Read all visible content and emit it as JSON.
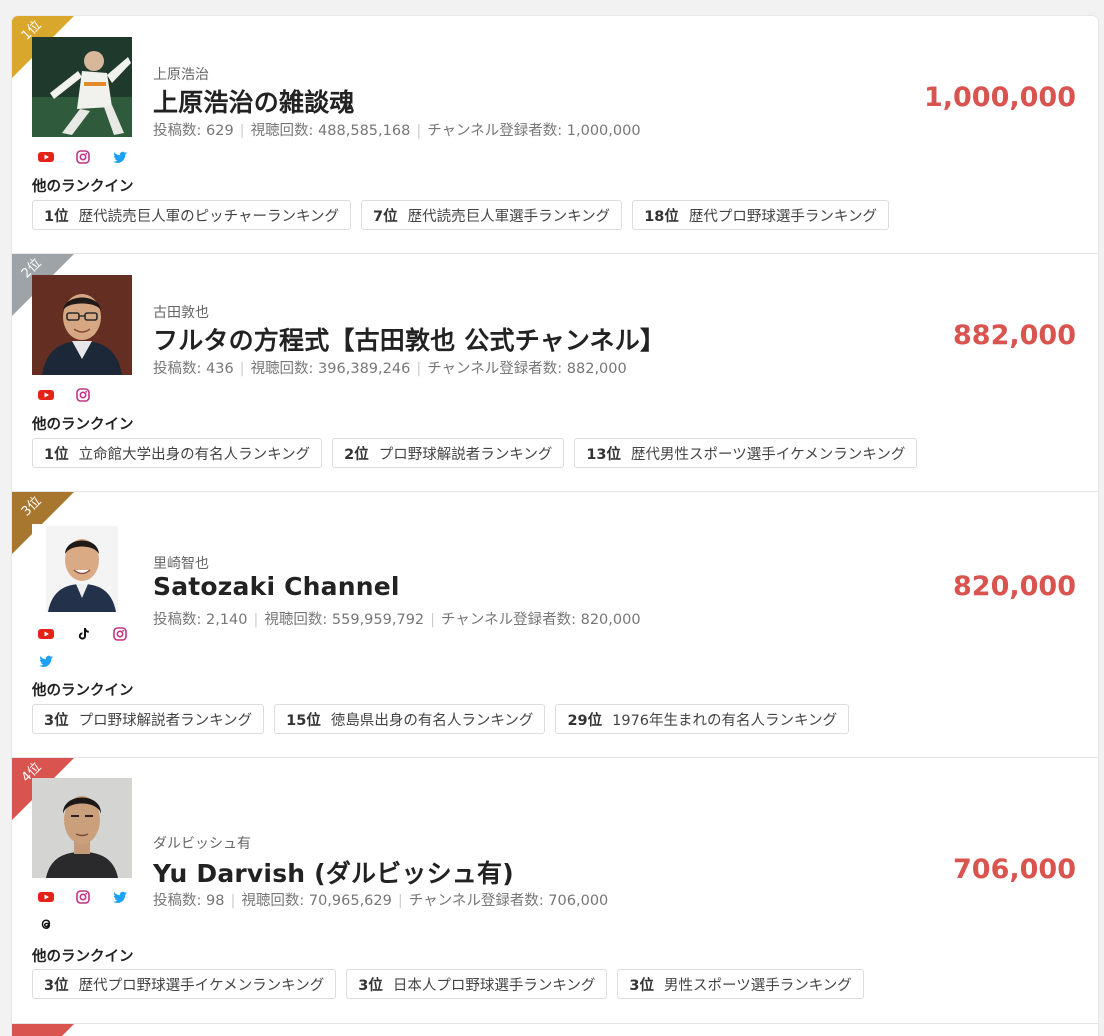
{
  "entries": [
    {
      "rank_label": "1位",
      "ribbon_color": "#d9a72c",
      "sub_name": "上原浩治",
      "channel_name": "上原浩治の雑談魂",
      "stats": {
        "posts": "投稿数: 629",
        "views": "視聴回数: 488,585,168",
        "subscribers": "チャンネル登録者数: 1,000,000"
      },
      "subscriber_count": "1,000,000",
      "sns": [
        "youtube-icon",
        "instagram-icon",
        "twitter-icon"
      ],
      "other_heading": "他のランクイン",
      "tags": [
        {
          "pos": "1位",
          "label": "歴代読売巨人軍のピッチャーランキング"
        },
        {
          "pos": "7位",
          "label": "歴代読売巨人軍選手ランキング"
        },
        {
          "pos": "18位",
          "label": "歴代プロ野球選手ランキング"
        }
      ]
    },
    {
      "rank_label": "2位",
      "ribbon_color": "#9ea3a8",
      "sub_name": "古田敦也",
      "channel_name": "フルタの方程式【古田敦也 公式チャンネル】",
      "stats": {
        "posts": "投稿数: 436",
        "views": "視聴回数: 396,389,246",
        "subscribers": "チャンネル登録者数: 882,000"
      },
      "subscriber_count": "882,000",
      "sns": [
        "youtube-icon",
        "instagram-icon"
      ],
      "other_heading": "他のランクイン",
      "tags": [
        {
          "pos": "1位",
          "label": "立命館大学出身の有名人ランキング"
        },
        {
          "pos": "2位",
          "label": "プロ野球解説者ランキング"
        },
        {
          "pos": "13位",
          "label": "歴代男性スポーツ選手イケメンランキング"
        }
      ]
    },
    {
      "rank_label": "3位",
      "ribbon_color": "#a8772f",
      "sub_name": "里崎智也",
      "channel_name": "Satozaki Channel",
      "stats": {
        "posts": "投稿数: 2,140",
        "views": "視聴回数: 559,959,792",
        "subscribers": "チャンネル登録者数: 820,000"
      },
      "subscriber_count": "820,000",
      "sns": [
        "youtube-icon",
        "tiktok-icon",
        "instagram-icon",
        "twitter-icon"
      ],
      "other_heading": "他のランクイン",
      "tags": [
        {
          "pos": "3位",
          "label": "プロ野球解説者ランキング"
        },
        {
          "pos": "15位",
          "label": "徳島県出身の有名人ランキング"
        },
        {
          "pos": "29位",
          "label": "1976年生まれの有名人ランキング"
        }
      ]
    },
    {
      "rank_label": "4位",
      "ribbon_color": "#d9534f",
      "sub_name": "ダルビッシュ有",
      "channel_name": "Yu Darvish (ダルビッシュ有)",
      "stats": {
        "posts": "投稿数: 98",
        "views": "視聴回数: 70,965,629",
        "subscribers": "チャンネル登録者数: 706,000"
      },
      "subscriber_count": "706,000",
      "sns": [
        "youtube-icon",
        "instagram-icon",
        "twitter-icon",
        "threads-icon"
      ],
      "other_heading": "他のランクイン",
      "tags": [
        {
          "pos": "3位",
          "label": "歴代プロ野球選手イケメンランキング"
        },
        {
          "pos": "3位",
          "label": "日本人プロ野球選手ランキング"
        },
        {
          "pos": "3位",
          "label": "男性スポーツ選手ランキング"
        }
      ]
    }
  ]
}
